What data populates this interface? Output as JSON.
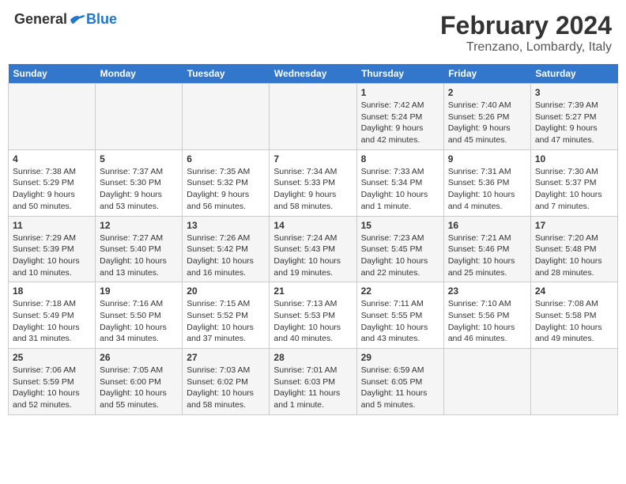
{
  "header": {
    "logo_general": "General",
    "logo_blue": "Blue",
    "month_title": "February 2024",
    "location": "Trenzano, Lombardy, Italy"
  },
  "weekdays": [
    "Sunday",
    "Monday",
    "Tuesday",
    "Wednesday",
    "Thursday",
    "Friday",
    "Saturday"
  ],
  "weeks": [
    [
      {
        "day": "",
        "info": ""
      },
      {
        "day": "",
        "info": ""
      },
      {
        "day": "",
        "info": ""
      },
      {
        "day": "",
        "info": ""
      },
      {
        "day": "1",
        "info": "Sunrise: 7:42 AM\nSunset: 5:24 PM\nDaylight: 9 hours\nand 42 minutes."
      },
      {
        "day": "2",
        "info": "Sunrise: 7:40 AM\nSunset: 5:26 PM\nDaylight: 9 hours\nand 45 minutes."
      },
      {
        "day": "3",
        "info": "Sunrise: 7:39 AM\nSunset: 5:27 PM\nDaylight: 9 hours\nand 47 minutes."
      }
    ],
    [
      {
        "day": "4",
        "info": "Sunrise: 7:38 AM\nSunset: 5:29 PM\nDaylight: 9 hours\nand 50 minutes."
      },
      {
        "day": "5",
        "info": "Sunrise: 7:37 AM\nSunset: 5:30 PM\nDaylight: 9 hours\nand 53 minutes."
      },
      {
        "day": "6",
        "info": "Sunrise: 7:35 AM\nSunset: 5:32 PM\nDaylight: 9 hours\nand 56 minutes."
      },
      {
        "day": "7",
        "info": "Sunrise: 7:34 AM\nSunset: 5:33 PM\nDaylight: 9 hours\nand 58 minutes."
      },
      {
        "day": "8",
        "info": "Sunrise: 7:33 AM\nSunset: 5:34 PM\nDaylight: 10 hours\nand 1 minute."
      },
      {
        "day": "9",
        "info": "Sunrise: 7:31 AM\nSunset: 5:36 PM\nDaylight: 10 hours\nand 4 minutes."
      },
      {
        "day": "10",
        "info": "Sunrise: 7:30 AM\nSunset: 5:37 PM\nDaylight: 10 hours\nand 7 minutes."
      }
    ],
    [
      {
        "day": "11",
        "info": "Sunrise: 7:29 AM\nSunset: 5:39 PM\nDaylight: 10 hours\nand 10 minutes."
      },
      {
        "day": "12",
        "info": "Sunrise: 7:27 AM\nSunset: 5:40 PM\nDaylight: 10 hours\nand 13 minutes."
      },
      {
        "day": "13",
        "info": "Sunrise: 7:26 AM\nSunset: 5:42 PM\nDaylight: 10 hours\nand 16 minutes."
      },
      {
        "day": "14",
        "info": "Sunrise: 7:24 AM\nSunset: 5:43 PM\nDaylight: 10 hours\nand 19 minutes."
      },
      {
        "day": "15",
        "info": "Sunrise: 7:23 AM\nSunset: 5:45 PM\nDaylight: 10 hours\nand 22 minutes."
      },
      {
        "day": "16",
        "info": "Sunrise: 7:21 AM\nSunset: 5:46 PM\nDaylight: 10 hours\nand 25 minutes."
      },
      {
        "day": "17",
        "info": "Sunrise: 7:20 AM\nSunset: 5:48 PM\nDaylight: 10 hours\nand 28 minutes."
      }
    ],
    [
      {
        "day": "18",
        "info": "Sunrise: 7:18 AM\nSunset: 5:49 PM\nDaylight: 10 hours\nand 31 minutes."
      },
      {
        "day": "19",
        "info": "Sunrise: 7:16 AM\nSunset: 5:50 PM\nDaylight: 10 hours\nand 34 minutes."
      },
      {
        "day": "20",
        "info": "Sunrise: 7:15 AM\nSunset: 5:52 PM\nDaylight: 10 hours\nand 37 minutes."
      },
      {
        "day": "21",
        "info": "Sunrise: 7:13 AM\nSunset: 5:53 PM\nDaylight: 10 hours\nand 40 minutes."
      },
      {
        "day": "22",
        "info": "Sunrise: 7:11 AM\nSunset: 5:55 PM\nDaylight: 10 hours\nand 43 minutes."
      },
      {
        "day": "23",
        "info": "Sunrise: 7:10 AM\nSunset: 5:56 PM\nDaylight: 10 hours\nand 46 minutes."
      },
      {
        "day": "24",
        "info": "Sunrise: 7:08 AM\nSunset: 5:58 PM\nDaylight: 10 hours\nand 49 minutes."
      }
    ],
    [
      {
        "day": "25",
        "info": "Sunrise: 7:06 AM\nSunset: 5:59 PM\nDaylight: 10 hours\nand 52 minutes."
      },
      {
        "day": "26",
        "info": "Sunrise: 7:05 AM\nSunset: 6:00 PM\nDaylight: 10 hours\nand 55 minutes."
      },
      {
        "day": "27",
        "info": "Sunrise: 7:03 AM\nSunset: 6:02 PM\nDaylight: 10 hours\nand 58 minutes."
      },
      {
        "day": "28",
        "info": "Sunrise: 7:01 AM\nSunset: 6:03 PM\nDaylight: 11 hours\nand 1 minute."
      },
      {
        "day": "29",
        "info": "Sunrise: 6:59 AM\nSunset: 6:05 PM\nDaylight: 11 hours\nand 5 minutes."
      },
      {
        "day": "",
        "info": ""
      },
      {
        "day": "",
        "info": ""
      }
    ]
  ]
}
